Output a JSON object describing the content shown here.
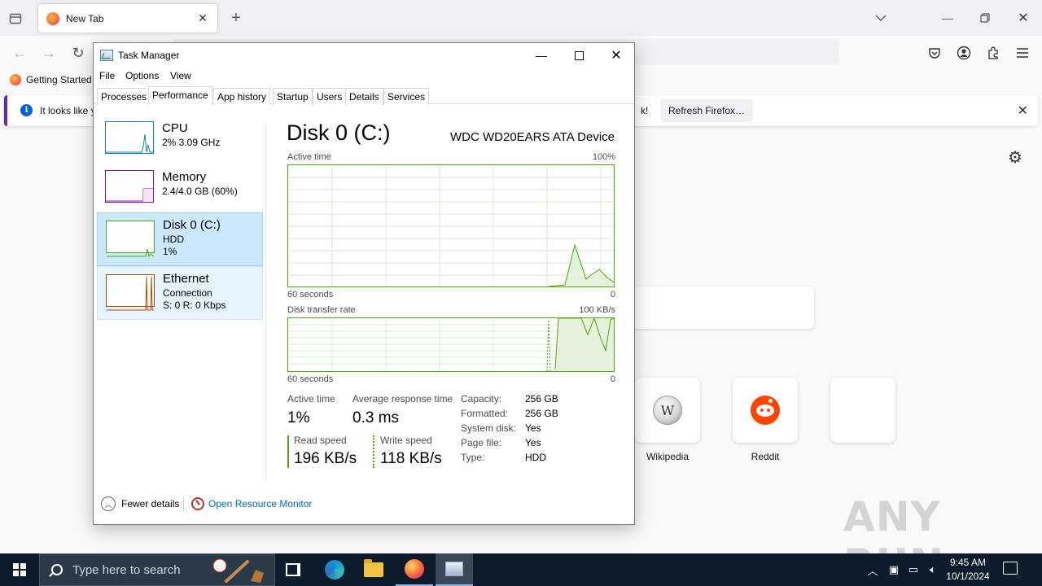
{
  "firefox": {
    "tab_title": "New Tab",
    "bookmark": "Getting Started",
    "notice_text": "It looks like y",
    "notice_tail": "k!",
    "refresh_button": "Refresh Firefox…",
    "tiles": [
      {
        "label": "Wikipedia",
        "icon": "wikipedia-icon"
      },
      {
        "label": "Reddit",
        "icon": "reddit-icon"
      },
      {
        "label": "",
        "icon": "empty-tile"
      }
    ],
    "watermark": "ANY RUN"
  },
  "task_manager": {
    "title": "Task Manager",
    "menu": [
      "File",
      "Options",
      "View"
    ],
    "tabs": [
      "Processes",
      "Performance",
      "App history",
      "Startup",
      "Users",
      "Details",
      "Services"
    ],
    "active_tab": "Performance",
    "sidebar": [
      {
        "name": "CPU",
        "line1": "2%  3.09 GHz",
        "line2": "",
        "color": "#117dbb"
      },
      {
        "name": "Memory",
        "line1": "2.4/4.0 GB (60%)",
        "line2": "",
        "color": "#8b12ae"
      },
      {
        "name": "Disk 0 (C:)",
        "line1": "HDD",
        "line2": "1%",
        "color": "#4da60c"
      },
      {
        "name": "Ethernet",
        "line1": "Connection",
        "line2": "S: 0  R: 0 Kbps",
        "color": "#a74f01"
      }
    ],
    "heading": "Disk 0 (C:)",
    "device": "WDC WD20EARS ATA Device",
    "active_graph": {
      "label": "Active time",
      "max": "100%",
      "xlabel": "60 seconds",
      "min": "0"
    },
    "rate_graph": {
      "label": "Disk transfer rate",
      "max": "100 KB/s",
      "xlabel": "60 seconds",
      "min": "0"
    },
    "stats": {
      "active_time_label": "Active time",
      "active_time_value": "1%",
      "avg_resp_label": "Average response time",
      "avg_resp_value": "0.3 ms",
      "read_label": "Read speed",
      "read_value": "196 KB/s",
      "write_label": "Write speed",
      "write_value": "118 KB/s"
    },
    "properties": [
      {
        "label": "Capacity:",
        "value": "256 GB"
      },
      {
        "label": "Formatted:",
        "value": "256 GB"
      },
      {
        "label": "System disk:",
        "value": "Yes"
      },
      {
        "label": "Page file:",
        "value": "Yes"
      },
      {
        "label": "Type:",
        "value": "HDD"
      }
    ],
    "footer": {
      "fewer": "Fewer details",
      "monitor": "Open Resource Monitor"
    }
  },
  "taskbar": {
    "search_placeholder": "Type here to search",
    "time": "9:45 AM",
    "date": "10/1/2024"
  },
  "colors": {
    "disk_green": "#4da60c",
    "selected": "#cce8ff",
    "taskbar": "#0c1c2c",
    "link": "#0066cc"
  }
}
